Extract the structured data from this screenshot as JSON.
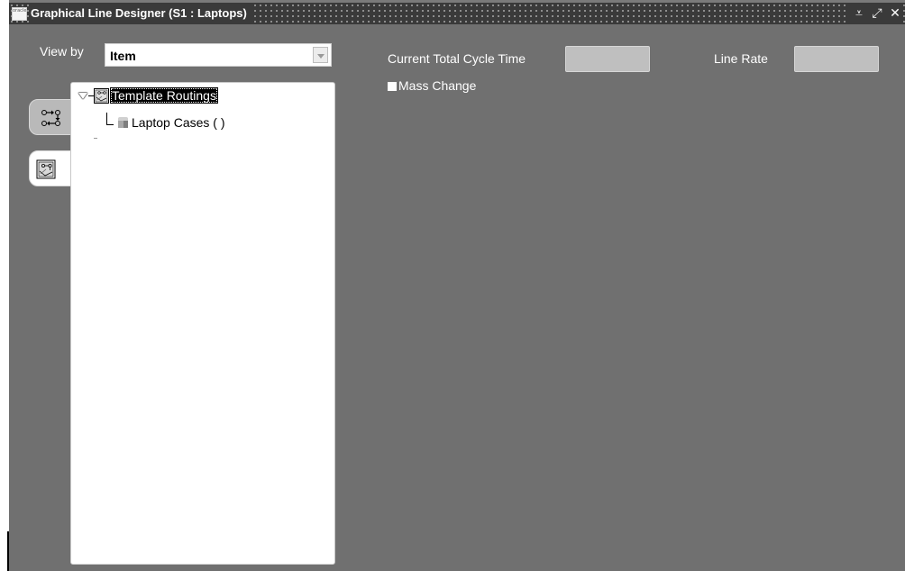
{
  "window": {
    "title": "Graphical Line Designer (S1 : Laptops)",
    "app_icon_text": "oracle",
    "controls": {
      "minimize_label": "⩡",
      "maximize_label": "⤢",
      "close_label": "✕"
    }
  },
  "view_by": {
    "label": "View by",
    "selected": "Item"
  },
  "side_tabs": [
    {
      "icon": "process-flow-icon",
      "active": false
    },
    {
      "icon": "routing-template-icon",
      "active": true
    }
  ],
  "tree": {
    "root": {
      "label": "Template Routings",
      "icon": "template-routing-icon",
      "expanded": true
    },
    "children": [
      {
        "label": "Laptop Cases ( )",
        "icon": "item-cube-icon"
      }
    ]
  },
  "header_fields": {
    "cycle_time_label": "Current Total Cycle Time",
    "cycle_time_value": "",
    "line_rate_label": "Line Rate",
    "line_rate_value": "",
    "mass_change_label": "Mass Change",
    "mass_change_checked": false
  },
  "colors": {
    "background": "#707070",
    "titlebar": "#3a3a3a",
    "field": "#bfbfbf",
    "tree_selection": "#000000"
  }
}
